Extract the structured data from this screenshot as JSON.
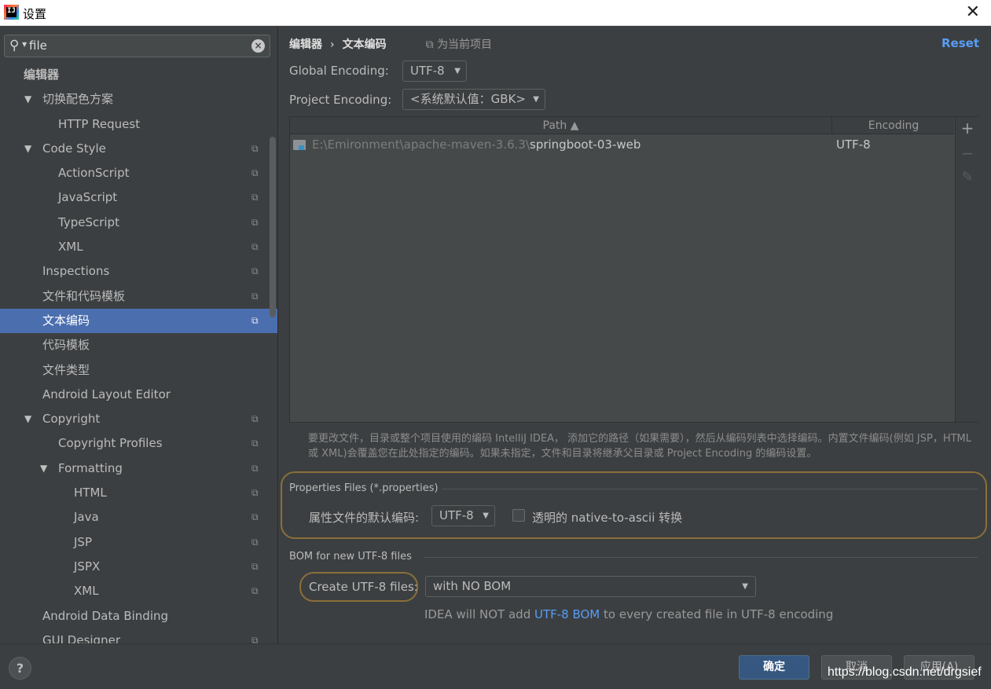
{
  "window": {
    "title": "设置"
  },
  "search": {
    "value": "file"
  },
  "tree": [
    {
      "label": "编辑器"
    },
    {
      "label": "切换配色方案"
    },
    {
      "label": "HTTP Request"
    },
    {
      "label": "Code Style"
    },
    {
      "label": "ActionScript"
    },
    {
      "label": "JavaScript"
    },
    {
      "label": "TypeScript"
    },
    {
      "label": "XML"
    },
    {
      "label": "Inspections"
    },
    {
      "label": "文件和代码模板"
    },
    {
      "label": "文本编码"
    },
    {
      "label": "代码模板"
    },
    {
      "label": "文件类型"
    },
    {
      "label": "Android Layout Editor"
    },
    {
      "label": "Copyright"
    },
    {
      "label": "Copyright Profiles"
    },
    {
      "label": "Formatting"
    },
    {
      "label": "HTML"
    },
    {
      "label": "Java"
    },
    {
      "label": "JSP"
    },
    {
      "label": "JSPX"
    },
    {
      "label": "XML"
    },
    {
      "label": "Android Data Binding"
    },
    {
      "label": "GUI Designer"
    }
  ],
  "breadcrumb": {
    "root": "编辑器",
    "separator": "›",
    "current": "文本编码",
    "for_project": "为当前项目"
  },
  "reset_label": "Reset",
  "global_encoding": {
    "label": "Global Encoding:",
    "value": "UTF-8"
  },
  "project_encoding": {
    "label": "Project Encoding:",
    "value": "<系统默认值：GBK>"
  },
  "table": {
    "col_path": "Path ▲",
    "col_encoding": "Encoding",
    "rows": [
      {
        "path_prefix": "E:\\Emironment\\apache-maven-3.6.3\\",
        "path_name": "springboot-03-web",
        "encoding": "UTF-8"
      }
    ],
    "toolbar": {
      "add": "+",
      "remove": "−",
      "edit": "✎"
    }
  },
  "hint": "要更改文件，目录或整个项目使用的编码 IntelliJ IDEA， 添加它的路径（如果需要），然后从编码列表中选择编码。内置文件编码(例如 JSP，HTML 或 XML)会覆盖您在此处指定的编码。如果未指定，文件和目录将继承父目录或 Project Encoding 的编码设置。",
  "properties": {
    "title": "Properties Files (*.properties)",
    "default_label": "属性文件的默认编码:",
    "default_value": "UTF-8",
    "native_ascii_label": "透明的 native-to-ascii 转换"
  },
  "bom": {
    "title": "BOM for new UTF-8 files",
    "create_label": "Create UTF-8 files:",
    "create_value": "with NO BOM",
    "info_prefix": "IDEA will NOT add ",
    "info_link": "UTF-8 BOM",
    "info_suffix": " to every created file in UTF-8 encoding"
  },
  "buttons": {
    "ok": "确定",
    "cancel": "取消",
    "apply": "应用(A)",
    "help": "?"
  },
  "watermark": "https://blog.csdn.net/drgsief"
}
